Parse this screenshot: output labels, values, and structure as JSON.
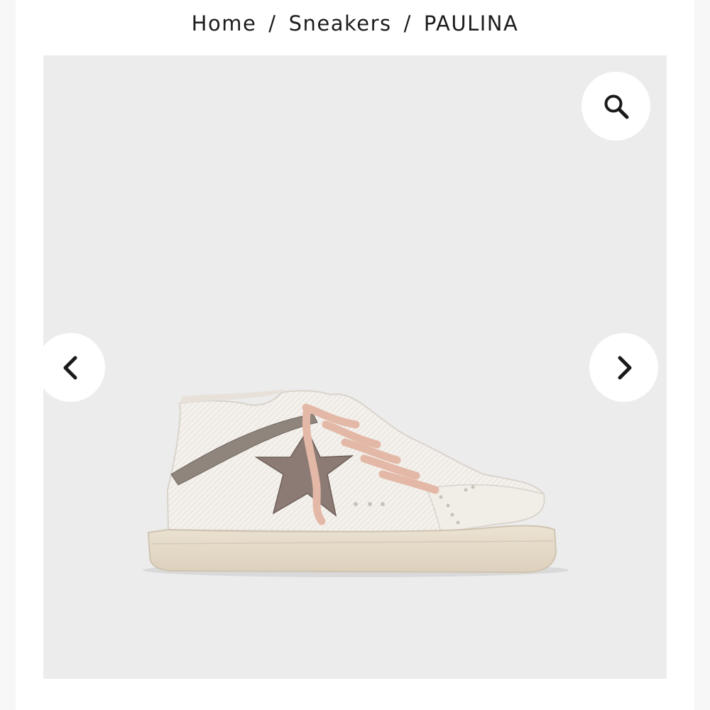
{
  "breadcrumb": {
    "items": [
      {
        "label": "Home"
      },
      {
        "label": "Sneakers"
      },
      {
        "label": "PAULINA"
      }
    ],
    "separator": "/"
  },
  "gallery": {
    "zoom_icon": "magnifier-icon",
    "prev_icon": "chevron-left-icon",
    "next_icon": "chevron-right-icon",
    "background_color": "#ececec",
    "product": {
      "upper_color": "#f4f1ed",
      "sole_color": "#e6dccb",
      "star_color": "#8c7b74",
      "lace_color": "#e3b8a6"
    }
  }
}
